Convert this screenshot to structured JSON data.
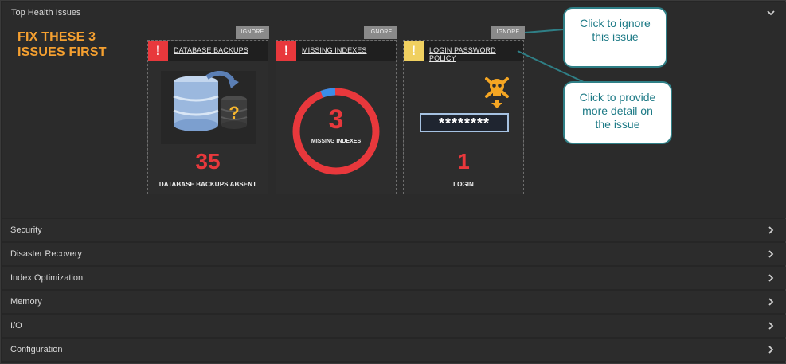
{
  "top_section": {
    "title": "Top Health Issues",
    "fix_label": "FIX THESE  3\nISSUES FIRST"
  },
  "cards": [
    {
      "title": "DATABASE BACKUPS",
      "severity": "critical",
      "ignore_label": "IGNORE",
      "value": "35",
      "caption": "DATABASE BACKUPS ABSENT",
      "icon": "database-question-icon"
    },
    {
      "title": "MISSING INDEXES",
      "severity": "critical",
      "ignore_label": "IGNORE",
      "value": "3",
      "caption": "MISSING INDEXES",
      "icon": "donut-gauge"
    },
    {
      "title": "LOGIN PASSWORD POLICY",
      "severity": "warning",
      "ignore_label": "IGNORE",
      "value": "1",
      "caption": "LOGIN",
      "password_mask": "********",
      "icon": "skull-password-icon"
    }
  ],
  "callouts": {
    "ignore": "Click to ignore\nthis issue",
    "detail": "Click to provide\nmore detail on\nthe issue"
  },
  "sections": [
    {
      "label": "Security"
    },
    {
      "label": "Disaster Recovery"
    },
    {
      "label": "Index Optimization"
    },
    {
      "label": "Memory"
    },
    {
      "label": "I/O"
    },
    {
      "label": "Configuration"
    }
  ],
  "colors": {
    "critical": "#e8383c",
    "warning": "#f0d060",
    "accent_orange": "#f5a030",
    "callout_text": "#1d7a86"
  }
}
